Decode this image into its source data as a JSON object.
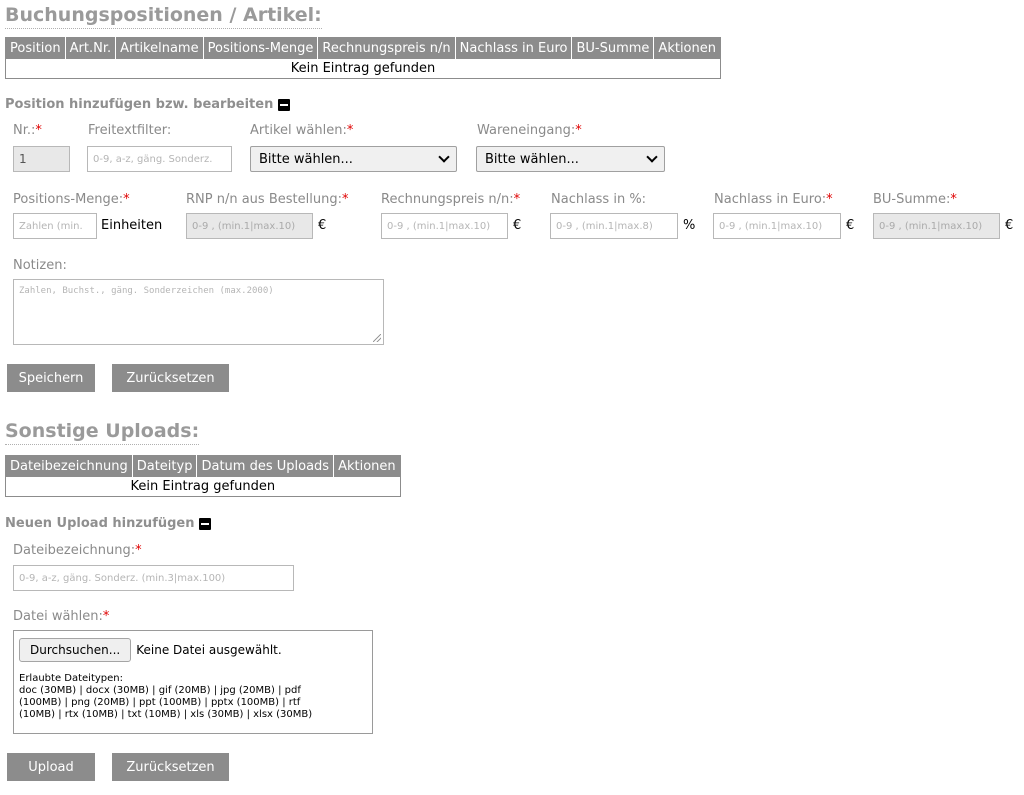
{
  "positions_section": {
    "title": "Buchungspositionen / Artikel:",
    "table": {
      "headers": [
        "Position",
        "Art.Nr.",
        "Artikelname",
        "Positions-Menge",
        "Rechnungspreis n/n",
        "Nachlass in Euro",
        "BU-Summe",
        "Aktionen"
      ],
      "empty_text": "Kein Eintrag gefunden"
    }
  },
  "position_form": {
    "title": "Position hinzufügen bzw. bearbeiten",
    "required_mark": "*",
    "nr": {
      "label": "Nr.:",
      "value": "1"
    },
    "freitext": {
      "label": "Freitextfilter:",
      "placeholder": "0-9, a-z, gäng. Sonderz."
    },
    "artikel": {
      "label": "Artikel wählen:",
      "selected": "Bitte wählen..."
    },
    "wareneingang": {
      "label": "Wareneingang:",
      "selected": "Bitte wählen..."
    },
    "menge": {
      "label": "Positions-Menge:",
      "placeholder": "Zahlen (min.",
      "unit": "Einheiten"
    },
    "rnp": {
      "label": "RNP n/n aus Bestellung:",
      "placeholder": "0-9 , (min.1|max.10)",
      "unit": "€"
    },
    "rechnungspreis": {
      "label": "Rechnungspreis n/n:",
      "placeholder": "0-9 , (min.1|max.10)",
      "unit": "€"
    },
    "nachlass_prozent": {
      "label": "Nachlass in %:",
      "placeholder": "0-9 , (min.1|max.8)",
      "unit": "%"
    },
    "nachlass_euro": {
      "label": "Nachlass in Euro:",
      "placeholder": "0-9 , (min.1|max.10)",
      "unit": "€"
    },
    "bu_summe": {
      "label": "BU-Summe:",
      "placeholder": "0-9 , (min.1|max.10)",
      "unit": "€"
    },
    "notizen": {
      "label": "Notizen:",
      "placeholder": "Zahlen, Buchst., gäng. Sonderzeichen (max.2000)"
    },
    "save_button": "Speichern",
    "reset_button": "Zurücksetzen"
  },
  "uploads_section": {
    "title": "Sonstige Uploads:",
    "table": {
      "headers": [
        "Dateibezeichnung",
        "Dateityp",
        "Datum des Uploads",
        "Aktionen"
      ],
      "empty_text": "Kein Eintrag gefunden"
    }
  },
  "upload_form": {
    "title": "Neuen Upload hinzufügen",
    "dateibezeichnung": {
      "label": "Dateibezeichnung:",
      "placeholder": "0-9, a-z, gäng. Sonderz. (min.3|max.100)"
    },
    "datei": {
      "label": "Datei wählen:",
      "browse_button": "Durchsuchen...",
      "no_file": "Keine Datei ausgewählt.",
      "allowed_title": "Erlaubte Dateitypen:",
      "allowed_lines": [
        "doc (30MB) | docx (30MB) | gif (20MB) | jpg (20MB) | pdf",
        "(100MB) | png (20MB) | ppt (100MB) | pptx (100MB) | rtf",
        "(10MB) | rtx (10MB) | txt (10MB) | xls (30MB) | xlsx (30MB)"
      ]
    },
    "upload_button": "Upload",
    "reset_button": "Zurücksetzen"
  }
}
